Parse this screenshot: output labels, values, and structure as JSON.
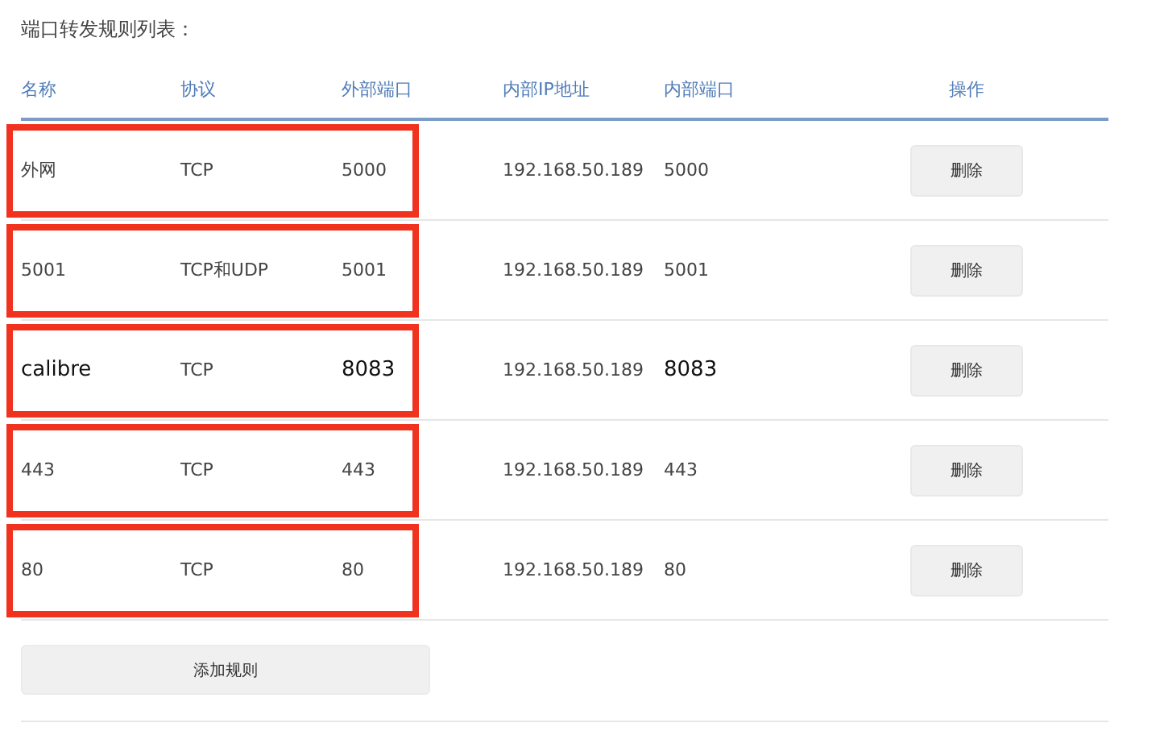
{
  "title": "端口转发规则列表：",
  "columns": [
    "名称",
    "协议",
    "外部端口",
    "内部IP地址",
    "内部端口",
    "操作"
  ],
  "rows": [
    {
      "name": "外网",
      "protocol": "TCP",
      "external_port": "5000",
      "internal_ip": "192.168.50.189",
      "internal_port": "5000",
      "action": "删除",
      "emphasized": false,
      "boxed": true
    },
    {
      "name": "5001",
      "protocol": "TCP和UDP",
      "external_port": "5001",
      "internal_ip": "192.168.50.189",
      "internal_port": "5001",
      "action": "删除",
      "emphasized": false,
      "boxed": true
    },
    {
      "name": "calibre",
      "protocol": "TCP",
      "external_port": "8083",
      "internal_ip": "192.168.50.189",
      "internal_port": "8083",
      "action": "删除",
      "emphasized": true,
      "boxed": true
    },
    {
      "name": "443",
      "protocol": "TCP",
      "external_port": "443",
      "internal_ip": "192.168.50.189",
      "internal_port": "443",
      "action": "删除",
      "emphasized": false,
      "boxed": true
    },
    {
      "name": "80",
      "protocol": "TCP",
      "external_port": "80",
      "internal_ip": "192.168.50.189",
      "internal_port": "80",
      "action": "删除",
      "emphasized": false,
      "boxed": true
    }
  ],
  "add_button": "添加规则"
}
